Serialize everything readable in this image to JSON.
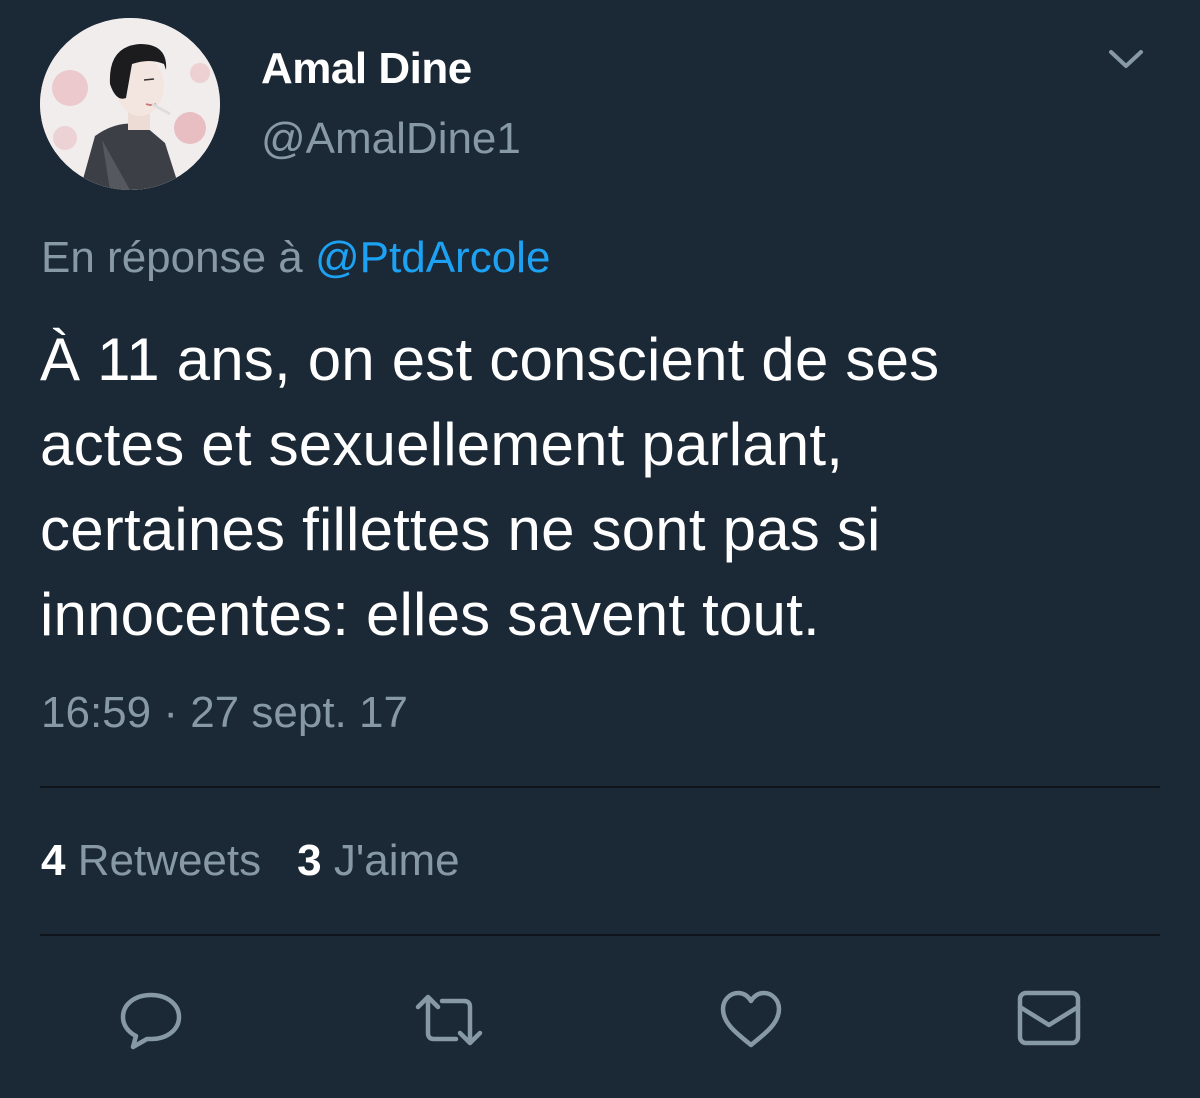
{
  "tweet": {
    "author": {
      "name": "Amal Dine",
      "handle": "@AmalDine1"
    },
    "reply": {
      "prefix": "En réponse à",
      "mention": "@PtdArcole"
    },
    "text": "À 11 ans, on est conscient de ses\nactes et sexuellement parlant,\ncertaines fillettes ne sont pas si\ninnocentes: elles savent tout.",
    "timestamp": "16:59 · 27 sept. 17",
    "stats": {
      "retweets_count": "4",
      "retweets_label": "Retweets",
      "likes_count": "3",
      "likes_label": "J'aime"
    },
    "actions": [
      {
        "name": "reply",
        "icon": "speech-bubble-icon"
      },
      {
        "name": "retweet",
        "icon": "retweet-icon"
      },
      {
        "name": "like",
        "icon": "heart-icon"
      },
      {
        "name": "message",
        "icon": "envelope-icon"
      }
    ]
  },
  "colors": {
    "background": "#1b2836",
    "secondary_text": "#8899a6",
    "link": "#1da1f2",
    "divider": "#0e141b",
    "icon": "#8899a6"
  }
}
